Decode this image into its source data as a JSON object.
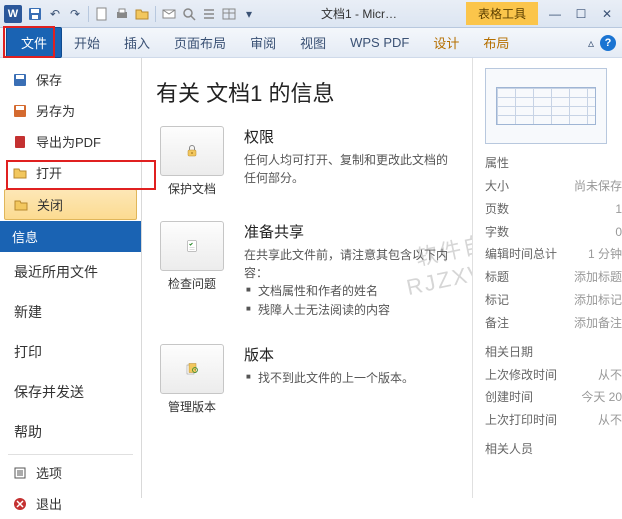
{
  "titlebar": {
    "title": "文档1 - Micr…",
    "tool_tab": "表格工具"
  },
  "ribbon": {
    "tabs": [
      "文件",
      "开始",
      "插入",
      "页面布局",
      "审阅",
      "视图",
      "WPS PDF",
      "设计",
      "布局"
    ]
  },
  "side": {
    "save": "保存",
    "save_as": "另存为",
    "export_pdf": "导出为PDF",
    "open": "打开",
    "close": "关闭",
    "info": "信息",
    "recent": "最近所用文件",
    "new": "新建",
    "print": "打印",
    "save_send": "保存并发送",
    "help": "帮助",
    "options": "选项",
    "exit": "退出"
  },
  "main": {
    "heading": "有关 文档1 的信息",
    "protect": {
      "btn": "保护文档",
      "h": "权限",
      "p": "任何人均可打开、复制和更改此文档的任何部分。"
    },
    "check": {
      "btn": "检查问题",
      "h": "准备共享",
      "p": "在共享此文件前，请注意其包含以下内容：",
      "li1": "文档属性和作者的姓名",
      "li2": "残障人士无法阅读的内容"
    },
    "version": {
      "btn": "管理版本",
      "h": "版本",
      "p": "找不到此文件的上一个版本。"
    }
  },
  "props": {
    "h1": "属性",
    "size_l": "大小",
    "size_v": "尚未保存",
    "pages_l": "页数",
    "pages_v": "1",
    "words_l": "字数",
    "words_v": "0",
    "edit_l": "编辑时间总计",
    "edit_v": "1 分钟",
    "title_l": "标题",
    "title_v": "添加标题",
    "tags_l": "标记",
    "tags_v": "添加标记",
    "notes_l": "备注",
    "notes_v": "添加备注",
    "h2": "相关日期",
    "mod_l": "上次修改时间",
    "mod_v": "从不",
    "create_l": "创建时间",
    "create_v": "今天 20",
    "print_l": "上次打印时间",
    "print_v": "从不",
    "h3": "相关人员"
  },
  "watermark": "软件自学网\nRJZXW.COM"
}
